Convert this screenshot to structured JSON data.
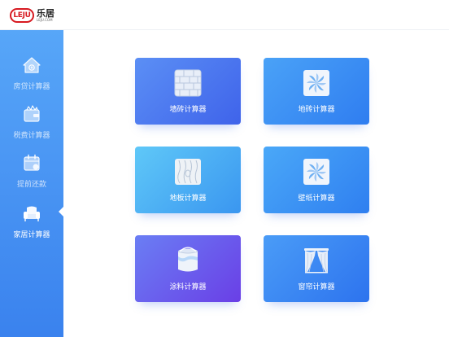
{
  "brand": {
    "badge": "LEJU",
    "name": "乐居",
    "domain": "LEJU.COM"
  },
  "sidebar": {
    "items": [
      {
        "label": "房贷计算器",
        "icon": "house-icon",
        "active": false
      },
      {
        "label": "税费计算器",
        "icon": "wallet-icon",
        "active": false
      },
      {
        "label": "提前还款",
        "icon": "calendar-icon",
        "active": false
      },
      {
        "label": "家居计算器",
        "icon": "sofa-icon",
        "active": true
      }
    ]
  },
  "main": {
    "cards": [
      {
        "label": "墙砖计算器",
        "icon": "brick-wall-icon"
      },
      {
        "label": "地砖计算器",
        "icon": "floor-tile-icon"
      },
      {
        "label": "地板计算器",
        "icon": "wood-floor-icon"
      },
      {
        "label": "壁纸计算器",
        "icon": "wallpaper-icon"
      },
      {
        "label": "涂料计算器",
        "icon": "paint-bucket-icon"
      },
      {
        "label": "窗帘计算器",
        "icon": "curtain-icon"
      }
    ]
  },
  "colors": {
    "sidebar_top": "#57a6f8",
    "sidebar_bottom": "#3a82ee",
    "brand_red": "#d71a21"
  }
}
